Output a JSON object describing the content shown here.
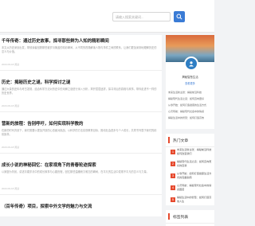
{
  "header": {
    "search_placeholder": "请输入搜索关键词..."
  },
  "articles": [
    {
      "title": "千年传奇：通过历史故事，探寻那些鲜为人知的精彩瞬间",
      "excerpt": "本文从历史深处出发，带领读者回顾那些被岁月掩盖的精彩瞬间，从不同的视角解读人物与事件之间的联系，让我们更加深刻地理解历史的意义与价值。",
      "meta": "2023-09-18  阅读"
    },
    {
      "title": "历史：揭秘历史之谜，科学探讨之谜",
      "excerpt": "通过大量的史料与考古发现，结合科学方法对历史中的未解之谜进行深入分析，揭开层层迷雾，探寻背后的真相与故事，带你走进不一样的历史世界。",
      "meta": "2023-09-18  阅读"
    },
    {
      "title": "营新的旅程：告别呼吁，如何实现科学教的",
      "excerpt": "在新的时代背景下，我们需要以更加开放的心态面对挑战，以科学的方法实现教育目标，推动社会进步与个人成长，共同书写属于我们的精彩篇章。",
      "meta": "2023-09-18  阅读"
    },
    {
      "title": "成长小说的神秘回忆：在家视角下的青春轮迹探索",
      "excerpt": "以家庭为背景，讲述青春岁月中的成长故事与心路历程，回忆那些温暖而又难忘的瞬间，在平凡的生活中发现不平凡的意义与力量。",
      "meta": "2023-09-18  阅读"
    },
    {
      "title": "（百年传奇）项目，探索中外文学的魅力与交流",
      "excerpt": "",
      "meta": ""
    }
  ],
  "profile": {
    "name": "揭秘智慧生活",
    "link": "查看更多",
    "items": [
      "未来生活新主张：揭秘前沿科技",
      "揭秘现代生活之道：如何迈向更好",
      "从零开始：如何打造健康的生活方式",
      "心灵导航：揭秘现代社会中的情感",
      "揭秘生活中的智慧：如何打造高效"
    ]
  },
  "hot": {
    "title": "热门文章",
    "items": [
      {
        "num": "1",
        "text": "未来生活新主张：揭秘前沿科技如何改变我们"
      },
      {
        "num": "2",
        "text": "揭秘现代生活之道：如何迈向更好的自我"
      },
      {
        "num": "3",
        "text": "从零开始：如何打造健康生活方式的完整指南"
      },
      {
        "num": "4",
        "text": "心灵导航：揭秘现代社会中的情感困惑"
      },
      {
        "num": "5",
        "text": "揭秘生活中的智慧：如何打造高效人生"
      }
    ]
  },
  "tags": {
    "title": "标签列表"
  }
}
